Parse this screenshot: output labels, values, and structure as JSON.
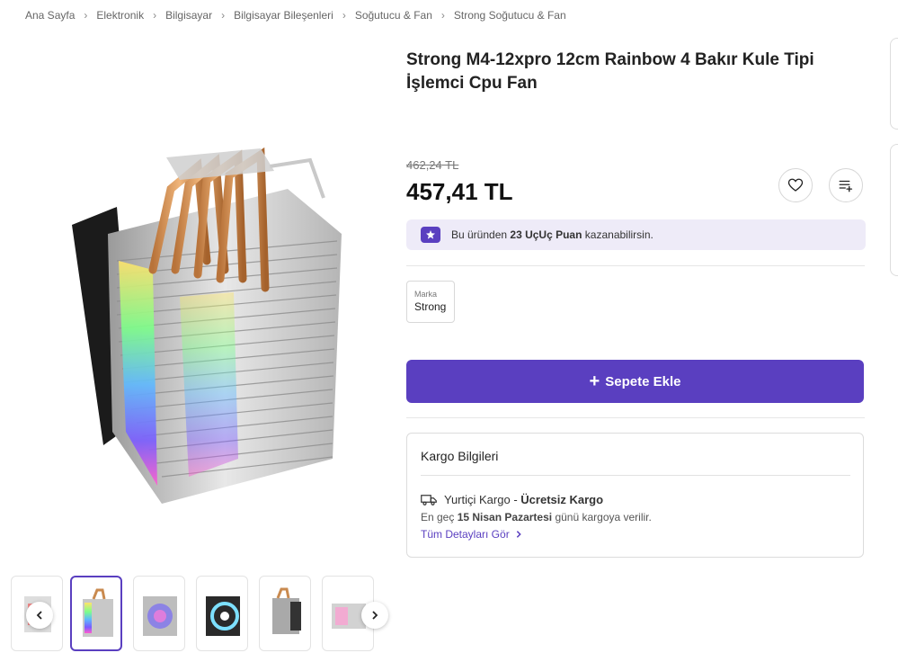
{
  "breadcrumb": [
    "Ana Sayfa",
    "Elektronik",
    "Bilgisayar",
    "Bilgisayar Bileşenleri",
    "Soğutucu & Fan",
    "Strong Soğutucu & Fan"
  ],
  "product": {
    "title": "Strong M4-12xpro 12cm Rainbow 4 Bakır Kule Tipi İşlemci Cpu Fan",
    "old_price": "462,24 TL",
    "price": "457,41 TL"
  },
  "points": {
    "prefix": "Bu üründen",
    "amount": "23 UçUç Puan",
    "suffix": "kazanabilirsin."
  },
  "brand": {
    "label": "Marka",
    "value": "Strong"
  },
  "cart": {
    "label": "Sepete Ekle"
  },
  "shipping": {
    "title": "Kargo Bilgileri",
    "carrier": "Yurtiçi Kargo",
    "dash": "-",
    "fee": "Ücretsiz Kargo",
    "eta_prefix": "En geç",
    "eta_date": "15 Nisan Pazartesi",
    "eta_suffix": "günü kargoya verilir.",
    "details_link": "Tüm Detayları Gör"
  },
  "colors": {
    "accent": "#5a3fc0",
    "points_bg": "#eeebf8"
  },
  "icons": [
    "chevron-right-icon",
    "heart-icon",
    "add-to-list-icon",
    "star-icon",
    "plus-icon",
    "truck-icon",
    "chevron-left-icon"
  ]
}
